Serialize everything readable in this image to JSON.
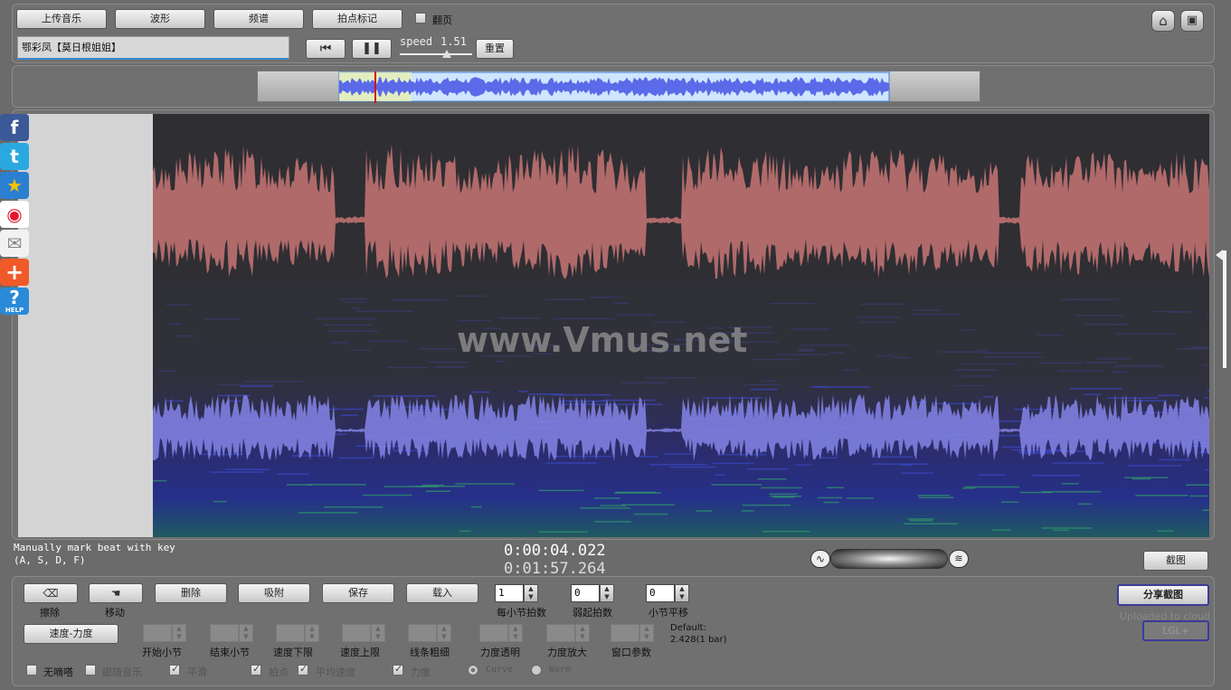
{
  "toolbar": {
    "upload_label": "上传音乐",
    "waveform_label": "波形",
    "spectrum_label": "频谱",
    "beat_mark_label": "拍点标记",
    "flip_page_label": "翻页",
    "track_title": "鄂彩凤【莫日根姐姐】",
    "speed_label": "speed",
    "speed_value": "1.51",
    "reset_label": "重置"
  },
  "overview": {
    "playhead_fraction": 0.13,
    "selection_start_fraction": 0.0,
    "selection_end_fraction": 0.75
  },
  "canvas": {
    "watermark": "www.Vmus.net"
  },
  "status": {
    "hint_line1": "Manually mark beat with key",
    "hint_line2": "(A, S, D, F)",
    "current_time": "0:00:04.022",
    "total_time": "0:01:57.264",
    "screenshot_label": "截图"
  },
  "social": [
    "facebook-icon",
    "twitter-icon",
    "favorite-star-icon",
    "weibo-icon",
    "email-icon",
    "add-plus-icon",
    "help-icon"
  ],
  "social_help_text": "HELP",
  "controls": {
    "erase_label": "擦除",
    "move_label": "移动",
    "delete_label": "删除",
    "attach_label": "吸附",
    "save_label": "保存",
    "load_label": "载入",
    "beats_per_bar": {
      "value": "1",
      "label": "每小节拍数"
    },
    "weak_beat": {
      "value": "0",
      "label": "弱起拍数"
    },
    "bar_shift": {
      "value": "0",
      "label": "小节平移"
    },
    "share_label": "分享截图",
    "uploaded_label": "Uploaded to cloud",
    "lgl_label": "LGL+",
    "tempo_label": "速度-力度",
    "params": [
      {
        "label": "开始小节"
      },
      {
        "label": "结束小节"
      },
      {
        "label": "速度下限"
      },
      {
        "label": "速度上限"
      },
      {
        "label": "线条粗细"
      },
      {
        "label": "力度透明"
      },
      {
        "label": "力度放大"
      },
      {
        "label": "窗口参数"
      }
    ],
    "default_label": "Default:",
    "default_value": "2.428(1 bar)",
    "options": [
      {
        "label": "无嘀嗒",
        "checked": false
      },
      {
        "label": "跟随音乐",
        "checked": false
      },
      {
        "label": "平滑",
        "checked": true
      },
      {
        "label": "拍点",
        "checked": true
      },
      {
        "label": "平均速度",
        "checked": true
      },
      {
        "label": "力度",
        "checked": true
      }
    ],
    "radio_curve": "Curve",
    "radio_worm": "Worm"
  }
}
